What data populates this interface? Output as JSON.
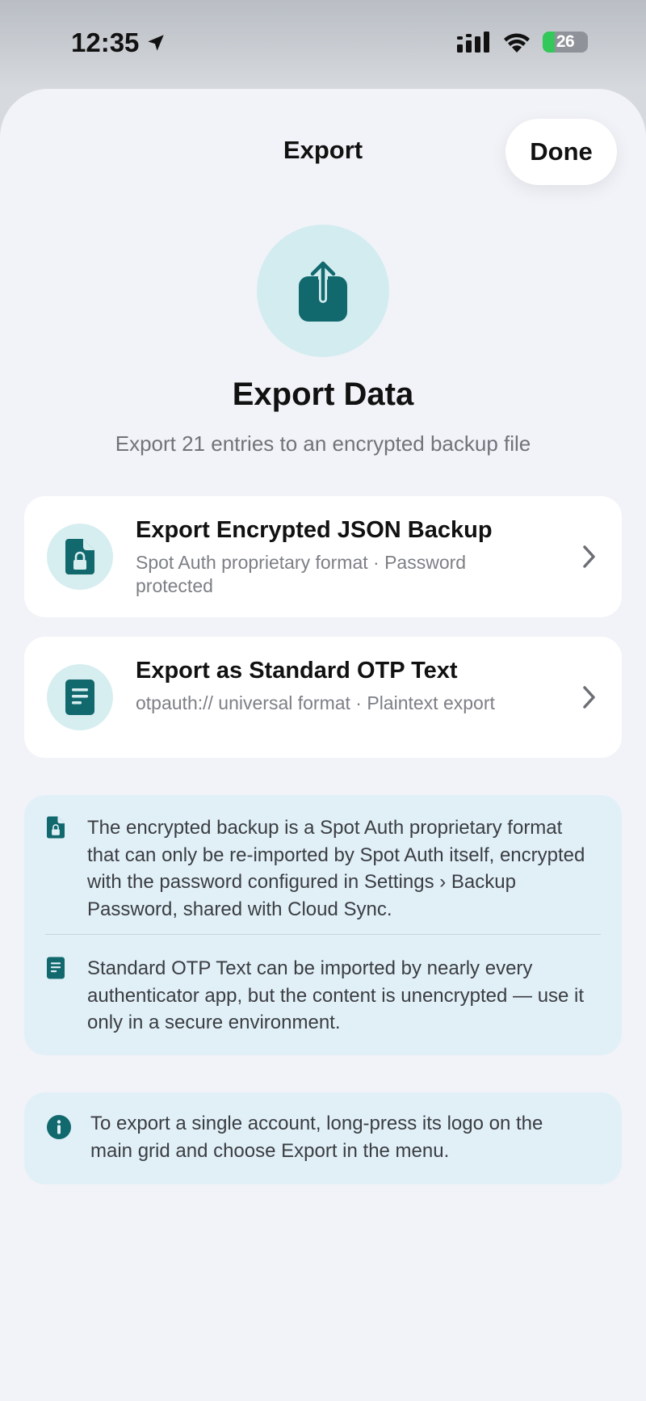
{
  "status_bar": {
    "time": "12:35",
    "battery": "26"
  },
  "nav": {
    "title": "Export",
    "done_label": "Done"
  },
  "hero": {
    "title": "Export Data",
    "subtitle": "Export 21 entries to an encrypted backup file"
  },
  "options": [
    {
      "title": "Export Encrypted JSON Backup",
      "subtitle": "Spot Auth proprietary format · Password protected",
      "icon": "lock-document-icon"
    },
    {
      "title": "Export as Standard OTP Text",
      "subtitle": "otpauth:// universal format · Plaintext export",
      "icon": "text-document-icon"
    }
  ],
  "info_notes": [
    {
      "icon": "lock-document-icon",
      "text": "The encrypted backup is a Spot Auth proprietary format that can only be re-imported by Spot Auth itself, encrypted with the password configured in Settings › Backup Password, shared with Cloud Sync."
    },
    {
      "icon": "text-document-icon",
      "text": "Standard OTP Text can be imported by nearly every authenticator app, but the content is unencrypted — use it only in a secure environment."
    }
  ],
  "tip": {
    "icon": "info-icon",
    "text": "To export a single account, long-press its logo on the main grid and choose Export in the menu."
  },
  "colors": {
    "accent": "#11686d",
    "icon_bg": "#d7eef0",
    "note_bg": "#e1f0f7",
    "sheet_bg": "#f2f3f8"
  }
}
